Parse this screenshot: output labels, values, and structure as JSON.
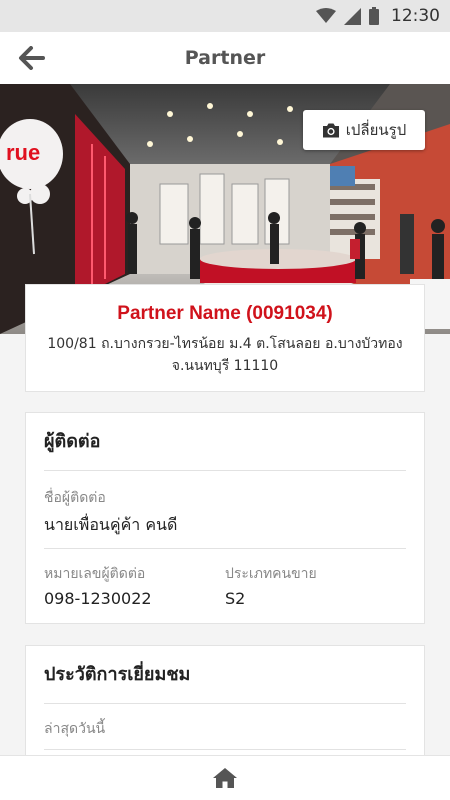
{
  "status_bar": {
    "time": "12:30"
  },
  "app_bar": {
    "title": "Partner"
  },
  "hero": {
    "change_photo_label": "เปลี่ยนรูป",
    "store_sign": "rue"
  },
  "partner": {
    "name": "Partner Name (0091034)",
    "address_line1": "100/81 ถ.บางกรวย-ไทรน้อย ม.4 ต.โสนลอย อ.บางบัวทอง",
    "address_line2": "จ.นนทบุรี 11110"
  },
  "contact": {
    "title": "ผู้ติดต่อ",
    "name_label": "ชื่อผู้ติดต่อ",
    "name_value": "นายเพื่อนคู่ค้า คนดี",
    "phone_label": "หมายเลขผู้ติดต่อ",
    "phone_value": "098-1230022",
    "type_label": "ประเภทคนขาย",
    "type_value": "S2"
  },
  "visit_history": {
    "title": "ประวัติการเยี่ยมชม",
    "latest_label": "ล่าสุดวันนี้"
  },
  "colors": {
    "accent": "#d0121b",
    "status_bar": "#e6e6e6"
  },
  "icons": [
    "wifi-icon",
    "signal-icon",
    "battery-icon",
    "back-arrow-icon",
    "camera-icon",
    "home-icon"
  ]
}
